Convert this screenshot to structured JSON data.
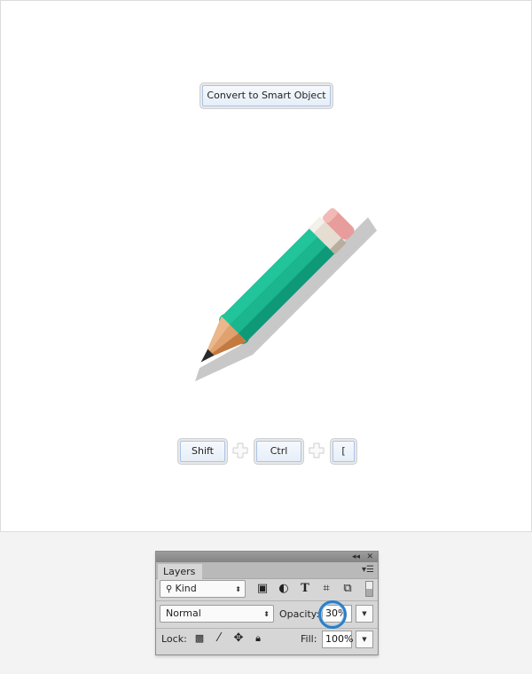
{
  "canvas": {
    "smart_object_button": "Convert to Smart Object",
    "shortcut_keys": [
      "Shift",
      "Ctrl",
      "["
    ],
    "illustration": "pencil-icon",
    "colors": {
      "pencil_body": "#1bb68e",
      "pencil_body_dark": "#0e9a78",
      "ferrule": "#e5ddd2",
      "eraser": "#e79d9b",
      "wood": "#e0a16e",
      "lead": "#2a2a2a",
      "shadow": "#c8c8c8",
      "key_border": "#a9c4e6"
    }
  },
  "layers_panel": {
    "title_icons": [
      "collapse-icon",
      "close-icon"
    ],
    "tab_label": "Layers",
    "filter": {
      "kind_label": "Kind",
      "filter_icons": [
        "image-filter-icon",
        "adjustment-filter-icon",
        "type-filter-icon",
        "shape-filter-icon",
        "smart-object-filter-icon"
      ]
    },
    "blend_mode": "Normal",
    "opacity_label": "Opacity:",
    "opacity_value": "30%",
    "lock_label": "Lock:",
    "lock_icons": [
      "lock-transparent-icon",
      "lock-paint-icon",
      "lock-position-icon",
      "lock-all-icon"
    ],
    "fill_label": "Fill:",
    "fill_value": "100%",
    "highlight_color": "#2b7fc7"
  }
}
